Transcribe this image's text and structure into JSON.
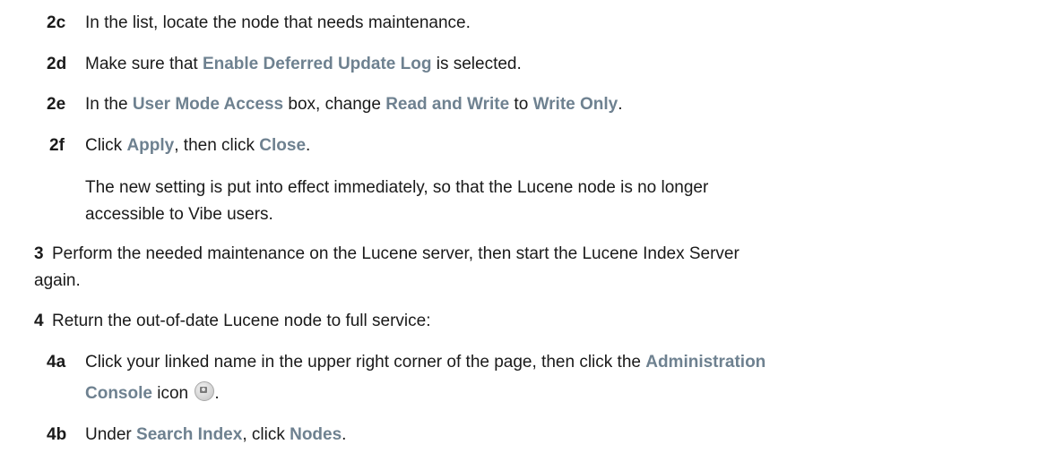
{
  "steps": {
    "s2c": {
      "num": "2c",
      "t1": "In the list, locate the node that needs maintenance."
    },
    "s2d": {
      "num": "2d",
      "t1": "Make sure that ",
      "ui1": "Enable Deferred Update Log",
      "t2": " is selected."
    },
    "s2e": {
      "num": "2e",
      "t1": "In the ",
      "ui1": "User Mode Access",
      "t2": " box, change ",
      "ui2": "Read and Write",
      "t3": " to ",
      "ui3": "Write Only",
      "t4": "."
    },
    "s2f": {
      "num": "2f",
      "t1": "Click ",
      "ui1": "Apply",
      "t2": ", then click ",
      "ui2": "Close",
      "t3": "."
    },
    "p2f": {
      "line1": "The new setting is put into effect immediately, so that the Lucene node is no longer",
      "line2": "accessible to Vibe users."
    },
    "s3": {
      "num": "3",
      "line1": "Perform the needed maintenance on the Lucene server, then start the Lucene Index Server",
      "line2": "again."
    },
    "s4": {
      "num": "4",
      "t1": "Return the out-of-date Lucene node to full service:"
    },
    "s4a": {
      "num": "4a",
      "t1": "Click your linked name in the upper right corner of the page, then click the ",
      "ui1": "Administration",
      "ui2": "Console",
      "t2": " icon ",
      "icon": "administration-console-icon",
      "t3": "."
    },
    "s4b": {
      "num": "4b",
      "t1": "Under ",
      "ui1": "Search Index",
      "t2": ", click ",
      "ui2": "Nodes",
      "t3": "."
    }
  }
}
